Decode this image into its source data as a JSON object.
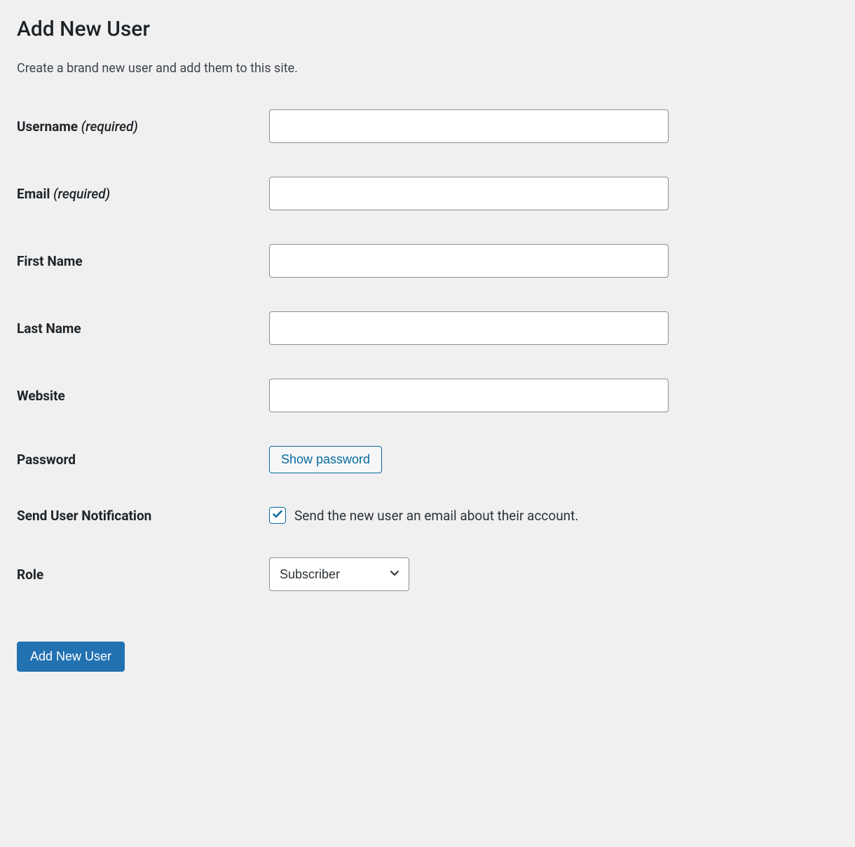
{
  "page": {
    "title": "Add New User",
    "description": "Create a brand new user and add them to this site."
  },
  "form": {
    "username": {
      "label": "Username",
      "required_text": "(required)",
      "value": ""
    },
    "email": {
      "label": "Email",
      "required_text": "(required)",
      "value": ""
    },
    "first_name": {
      "label": "First Name",
      "value": ""
    },
    "last_name": {
      "label": "Last Name",
      "value": ""
    },
    "website": {
      "label": "Website",
      "value": ""
    },
    "password": {
      "label": "Password",
      "show_button": "Show password"
    },
    "notification": {
      "label": "Send User Notification",
      "checkbox_label": "Send the new user an email about their account.",
      "checked": true
    },
    "role": {
      "label": "Role",
      "selected": "Subscriber",
      "options": [
        "Subscriber"
      ]
    },
    "submit_label": "Add New User"
  }
}
